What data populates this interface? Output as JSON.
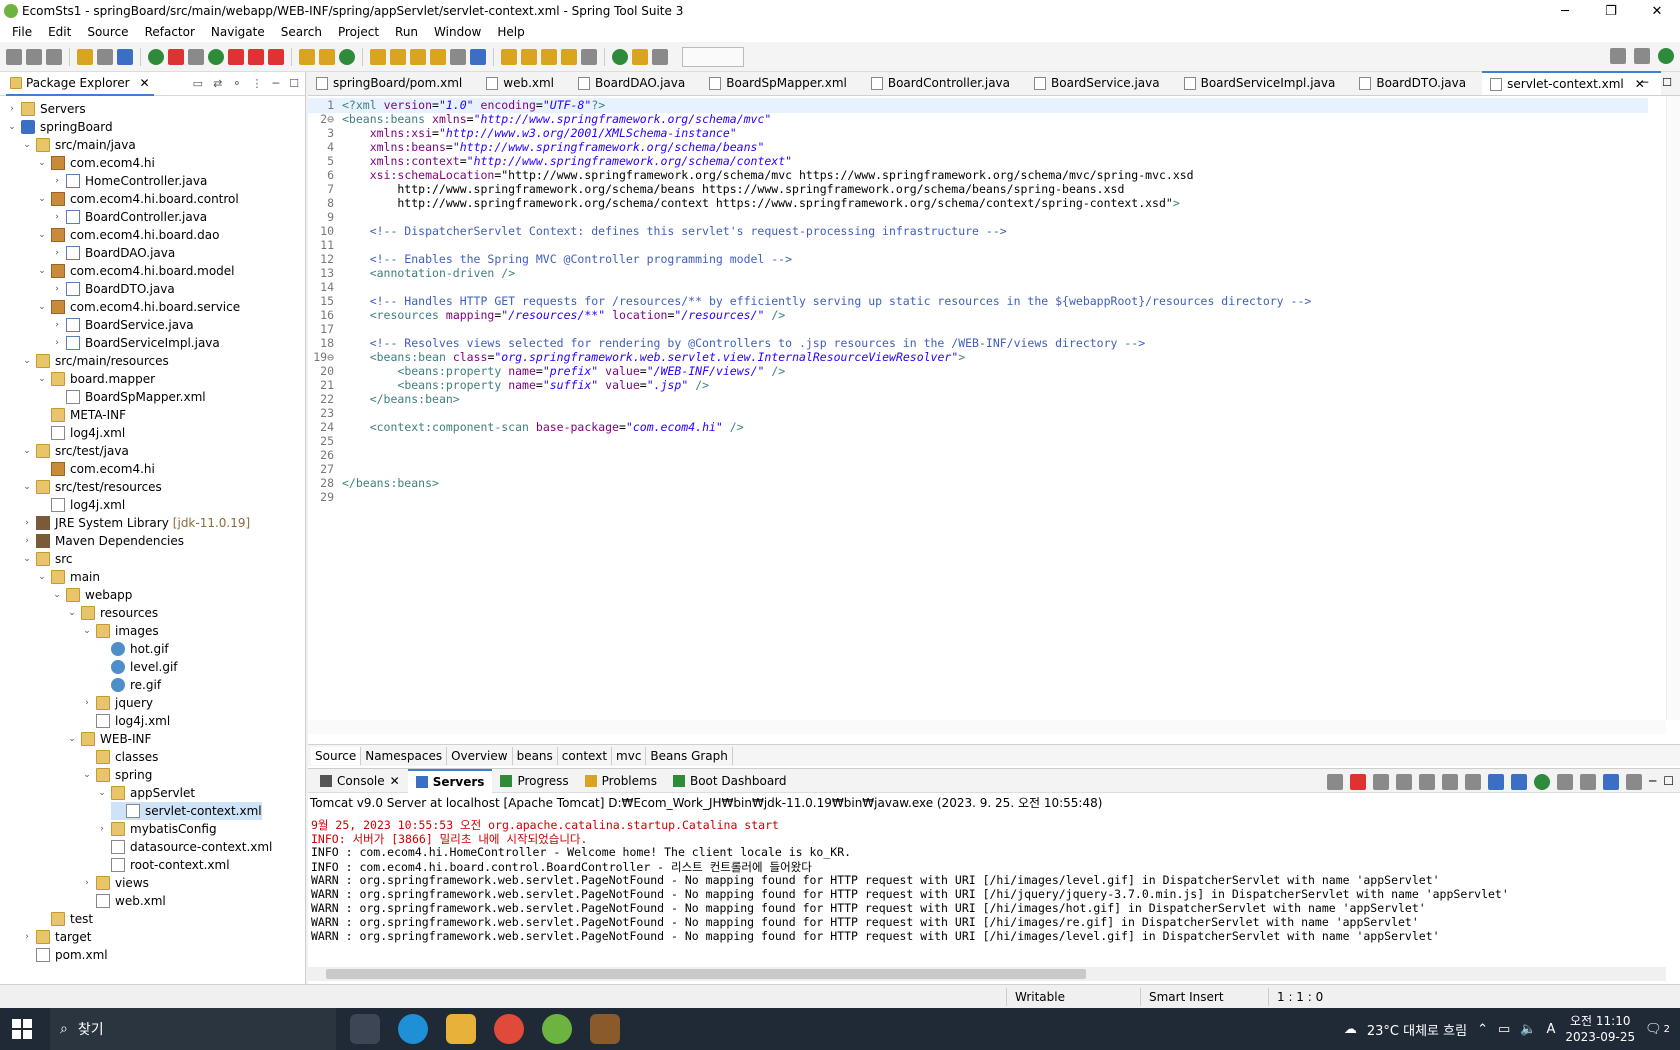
{
  "window": {
    "title": "EcomSts1 - springBoard/src/main/webapp/WEB-INF/spring/appServlet/servlet-context.xml - Spring Tool Suite 3",
    "minimize": "─",
    "restore": "❐",
    "close": "✕"
  },
  "menu": [
    "File",
    "Edit",
    "Source",
    "Refactor",
    "Navigate",
    "Search",
    "Project",
    "Run",
    "Window",
    "Help"
  ],
  "package_explorer": {
    "title": "Package Explorer",
    "close": "✕",
    "tree": [
      {
        "label": "Servers",
        "level": 0,
        "twisty": "›",
        "icon": "folder"
      },
      {
        "label": "springBoard",
        "level": 0,
        "twisty": "⌄",
        "icon": "proj"
      },
      {
        "label": "src/main/java",
        "level": 1,
        "twisty": "⌄",
        "icon": "folder"
      },
      {
        "label": "com.ecom4.hi",
        "level": 2,
        "twisty": "⌄",
        "icon": "pkgi"
      },
      {
        "label": "HomeController.java",
        "level": 3,
        "twisty": "›",
        "icon": "java"
      },
      {
        "label": "com.ecom4.hi.board.control",
        "level": 2,
        "twisty": "⌄",
        "icon": "pkgi"
      },
      {
        "label": "BoardController.java",
        "level": 3,
        "twisty": "›",
        "icon": "java"
      },
      {
        "label": "com.ecom4.hi.board.dao",
        "level": 2,
        "twisty": "⌄",
        "icon": "pkgi"
      },
      {
        "label": "BoardDAO.java",
        "level": 3,
        "twisty": "›",
        "icon": "java"
      },
      {
        "label": "com.ecom4.hi.board.model",
        "level": 2,
        "twisty": "⌄",
        "icon": "pkgi"
      },
      {
        "label": "BoardDTO.java",
        "level": 3,
        "twisty": "›",
        "icon": "java"
      },
      {
        "label": "com.ecom4.hi.board.service",
        "level": 2,
        "twisty": "⌄",
        "icon": "pkgi"
      },
      {
        "label": "BoardService.java",
        "level": 3,
        "twisty": "›",
        "icon": "java"
      },
      {
        "label": "BoardServiceImpl.java",
        "level": 3,
        "twisty": "›",
        "icon": "java"
      },
      {
        "label": "src/main/resources",
        "level": 1,
        "twisty": "⌄",
        "icon": "folder"
      },
      {
        "label": "board.mapper",
        "level": 2,
        "twisty": "⌄",
        "icon": "folder"
      },
      {
        "label": "BoardSpMapper.xml",
        "level": 3,
        "twisty": "",
        "icon": "xml"
      },
      {
        "label": "META-INF",
        "level": 2,
        "twisty": "",
        "icon": "folder"
      },
      {
        "label": "log4j.xml",
        "level": 2,
        "twisty": "",
        "icon": "xml"
      },
      {
        "label": "src/test/java",
        "level": 1,
        "twisty": "⌄",
        "icon": "folder"
      },
      {
        "label": "com.ecom4.hi",
        "level": 2,
        "twisty": "",
        "icon": "pkgi"
      },
      {
        "label": "src/test/resources",
        "level": 1,
        "twisty": "⌄",
        "icon": "folder"
      },
      {
        "label": "log4j.xml",
        "level": 2,
        "twisty": "",
        "icon": "xml"
      },
      {
        "label": "JRE System Library",
        "level": 1,
        "twisty": "›",
        "icon": "lib",
        "tag": "[jdk-11.0.19]"
      },
      {
        "label": "Maven Dependencies",
        "level": 1,
        "twisty": "›",
        "icon": "lib"
      },
      {
        "label": "src",
        "level": 1,
        "twisty": "⌄",
        "icon": "folder"
      },
      {
        "label": "main",
        "level": 2,
        "twisty": "⌄",
        "icon": "folder"
      },
      {
        "label": "webapp",
        "level": 3,
        "twisty": "⌄",
        "icon": "folder"
      },
      {
        "label": "resources",
        "level": 4,
        "twisty": "⌄",
        "icon": "folder"
      },
      {
        "label": "images",
        "level": 5,
        "twisty": "⌄",
        "icon": "folder"
      },
      {
        "label": "hot.gif",
        "level": 6,
        "twisty": "",
        "icon": "gif"
      },
      {
        "label": "level.gif",
        "level": 6,
        "twisty": "",
        "icon": "gif"
      },
      {
        "label": "re.gif",
        "level": 6,
        "twisty": "",
        "icon": "gif"
      },
      {
        "label": "jquery",
        "level": 5,
        "twisty": "›",
        "icon": "folder"
      },
      {
        "label": "log4j.xml",
        "level": 5,
        "twisty": "",
        "icon": "xml"
      },
      {
        "label": "WEB-INF",
        "level": 4,
        "twisty": "⌄",
        "icon": "folder"
      },
      {
        "label": "classes",
        "level": 5,
        "twisty": "",
        "icon": "folder"
      },
      {
        "label": "spring",
        "level": 5,
        "twisty": "⌄",
        "icon": "folder"
      },
      {
        "label": "appServlet",
        "level": 6,
        "twisty": "⌄",
        "icon": "folder"
      },
      {
        "label": "servlet-context.xml",
        "level": 7,
        "twisty": "",
        "icon": "xml",
        "selected": true
      },
      {
        "label": "mybatisConfig",
        "level": 6,
        "twisty": "›",
        "icon": "folder"
      },
      {
        "label": "datasource-context.xml",
        "level": 6,
        "twisty": "",
        "icon": "xml"
      },
      {
        "label": "root-context.xml",
        "level": 6,
        "twisty": "",
        "icon": "xml"
      },
      {
        "label": "views",
        "level": 5,
        "twisty": "›",
        "icon": "folder"
      },
      {
        "label": "web.xml",
        "level": 5,
        "twisty": "",
        "icon": "xml"
      },
      {
        "label": "test",
        "level": 2,
        "twisty": "",
        "icon": "folder"
      },
      {
        "label": "target",
        "level": 1,
        "twisty": "›",
        "icon": "folder"
      },
      {
        "label": "pom.xml",
        "level": 1,
        "twisty": "",
        "icon": "xml"
      }
    ]
  },
  "editor": {
    "tabs": [
      {
        "label": "springBoard/pom.xml",
        "active": false
      },
      {
        "label": "web.xml",
        "active": false
      },
      {
        "label": "BoardDAO.java",
        "active": false
      },
      {
        "label": "BoardSpMapper.xml",
        "active": false
      },
      {
        "label": "BoardController.java",
        "active": false
      },
      {
        "label": "BoardService.java",
        "active": false
      },
      {
        "label": "BoardServiceImpl.java",
        "active": false
      },
      {
        "label": "BoardDTO.java",
        "active": false
      },
      {
        "label": "servlet-context.xml",
        "active": true
      }
    ],
    "lines": [
      {
        "n": "1",
        "t": "<?xml version=\"1.0\" encoding=\"UTF-8\"?>"
      },
      {
        "n": "2⊖",
        "t": "<beans:beans xmlns=\"http://www.springframework.org/schema/mvc\""
      },
      {
        "n": "3",
        "t": "    xmlns:xsi=\"http://www.w3.org/2001/XMLSchema-instance\""
      },
      {
        "n": "4",
        "t": "    xmlns:beans=\"http://www.springframework.org/schema/beans\""
      },
      {
        "n": "5",
        "t": "    xmlns:context=\"http://www.springframework.org/schema/context\""
      },
      {
        "n": "6",
        "t": "    xsi:schemaLocation=\"http://www.springframework.org/schema/mvc https://www.springframework.org/schema/mvc/spring-mvc.xsd"
      },
      {
        "n": "7",
        "t": "        http://www.springframework.org/schema/beans https://www.springframework.org/schema/beans/spring-beans.xsd"
      },
      {
        "n": "8",
        "t": "        http://www.springframework.org/schema/context https://www.springframework.org/schema/context/spring-context.xsd\">"
      },
      {
        "n": "9",
        "t": ""
      },
      {
        "n": "10",
        "t": "    <!-- DispatcherServlet Context: defines this servlet's request-processing infrastructure -->"
      },
      {
        "n": "11",
        "t": ""
      },
      {
        "n": "12",
        "t": "    <!-- Enables the Spring MVC @Controller programming model -->"
      },
      {
        "n": "13",
        "t": "    <annotation-driven />"
      },
      {
        "n": "14",
        "t": ""
      },
      {
        "n": "15",
        "t": "    <!-- Handles HTTP GET requests for /resources/** by efficiently serving up static resources in the ${webappRoot}/resources directory -->"
      },
      {
        "n": "16",
        "t": "    <resources mapping=\"/resources/**\" location=\"/resources/\" />"
      },
      {
        "n": "17",
        "t": ""
      },
      {
        "n": "18",
        "t": "    <!-- Resolves views selected for rendering by @Controllers to .jsp resources in the /WEB-INF/views directory -->"
      },
      {
        "n": "19⊖",
        "t": "    <beans:bean class=\"org.springframework.web.servlet.view.InternalResourceViewResolver\">"
      },
      {
        "n": "20",
        "t": "        <beans:property name=\"prefix\" value=\"/WEB-INF/views/\" />"
      },
      {
        "n": "21",
        "t": "        <beans:property name=\"suffix\" value=\".jsp\" />"
      },
      {
        "n": "22",
        "t": "    </beans:bean>"
      },
      {
        "n": "23",
        "t": ""
      },
      {
        "n": "24",
        "t": "    <context:component-scan base-package=\"com.ecom4.hi\" />"
      },
      {
        "n": "25",
        "t": ""
      },
      {
        "n": "26",
        "t": ""
      },
      {
        "n": "27",
        "t": ""
      },
      {
        "n": "28",
        "t": "</beans:beans>"
      },
      {
        "n": "29",
        "t": ""
      }
    ],
    "bottom_tabs": [
      "Source",
      "Namespaces",
      "Overview",
      "beans",
      "context",
      "mvc",
      "Beans Graph"
    ]
  },
  "console": {
    "tabs": [
      {
        "label": "Console",
        "active": false,
        "close": "✕"
      },
      {
        "label": "Servers",
        "active": true
      },
      {
        "label": "Progress",
        "active": false
      },
      {
        "label": "Problems",
        "active": false
      },
      {
        "label": "Boot Dashboard",
        "active": false
      }
    ],
    "status": "Tomcat v9.0 Server at localhost [Apache Tomcat] D:₩Ecom_Work_JH₩bin₩jdk-11.0.19₩bin₩javaw.exe  (2023. 9. 25. 오전 10:55:48)",
    "lines": [
      {
        "t": "9월 25, 2023 10:55:53 오전 org.apache.catalina.startup.Catalina start",
        "red": true
      },
      {
        "t": "INFO: 서버가 [3866] 밀리초 내에 시작되었습니다.",
        "red": true
      },
      {
        "t": "INFO : com.ecom4.hi.HomeController - Welcome home! The client locale is ko_KR.",
        "red": false
      },
      {
        "t": "INFO : com.ecom4.hi.board.control.BoardController - 리스트 컨트롤러에 들어왔다",
        "red": false
      },
      {
        "t": "WARN : org.springframework.web.servlet.PageNotFound - No mapping found for HTTP request with URI [/hi/images/level.gif] in DispatcherServlet with name 'appServlet'",
        "red": false
      },
      {
        "t": "WARN : org.springframework.web.servlet.PageNotFound - No mapping found for HTTP request with URI [/hi/jquery/jquery-3.7.0.min.js] in DispatcherServlet with name 'appServlet'",
        "red": false
      },
      {
        "t": "WARN : org.springframework.web.servlet.PageNotFound - No mapping found for HTTP request with URI [/hi/images/hot.gif] in DispatcherServlet with name 'appServlet'",
        "red": false
      },
      {
        "t": "WARN : org.springframework.web.servlet.PageNotFound - No mapping found for HTTP request with URI [/hi/images/re.gif] in DispatcherServlet with name 'appServlet'",
        "red": false
      },
      {
        "t": "WARN : org.springframework.web.servlet.PageNotFound - No mapping found for HTTP request with URI [/hi/images/level.gif] in DispatcherServlet with name 'appServlet'",
        "red": false
      }
    ]
  },
  "statusbar": {
    "mode": "Writable",
    "insert": "Smart Insert",
    "position": "1 : 1 : 0"
  },
  "taskbar": {
    "search_placeholder": "찾기",
    "weather": "23°C 대체로 흐림",
    "time": "오전 11:10",
    "date": "2023-09-25",
    "input_mode": "A",
    "notifications": "2"
  },
  "colors": {
    "accent": "#3d7fd6",
    "console_red": "#d00000",
    "xml_tag": "#3f7f7f",
    "xml_attr": "#7f007f",
    "xml_value": "#2a00ff",
    "xml_comment": "#3f5fbf"
  }
}
